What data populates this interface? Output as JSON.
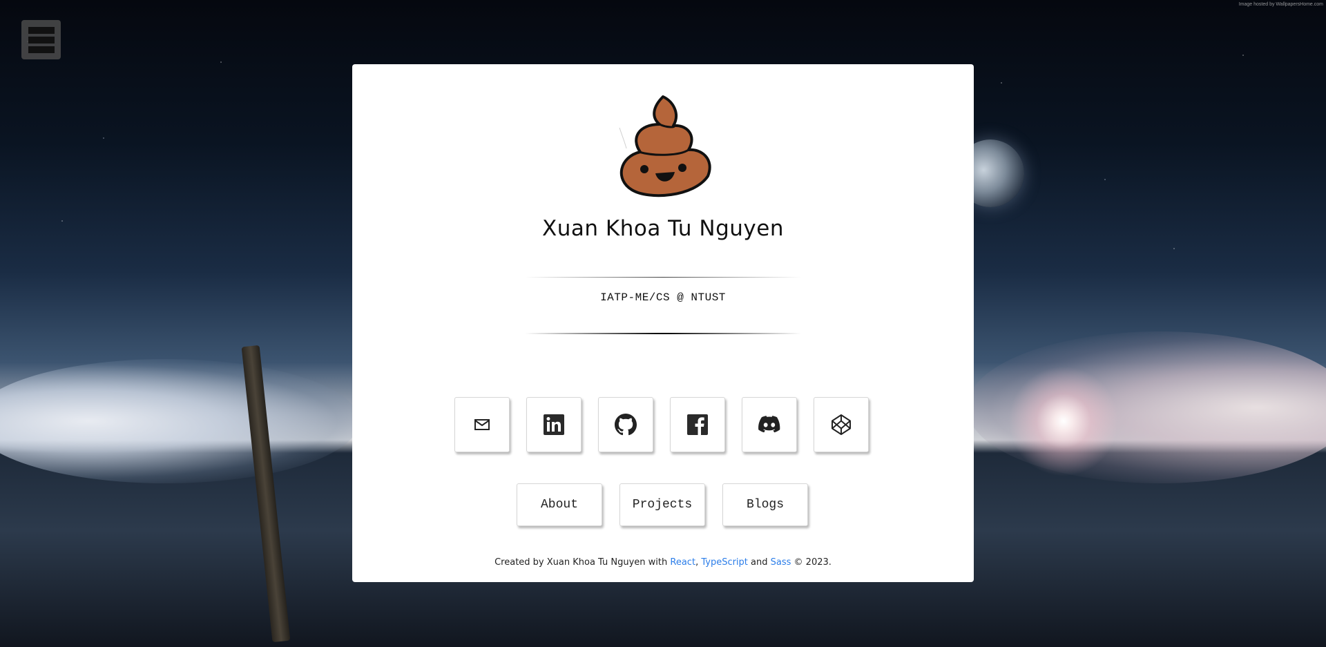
{
  "page": {
    "image_credit": "Image hosted by WallpapersHome.com"
  },
  "menu": {
    "icon": "menu-icon"
  },
  "profile": {
    "logo_icon": "poop-emoji-logo",
    "name": "Xuan Khoa Tu Nguyen",
    "tagline": "IATP-ME/CS @ NTUST"
  },
  "socials": [
    {
      "name": "email",
      "icon": "mail-icon"
    },
    {
      "name": "linkedin",
      "icon": "linkedin-icon"
    },
    {
      "name": "github",
      "icon": "github-icon"
    },
    {
      "name": "facebook",
      "icon": "facebook-icon"
    },
    {
      "name": "discord",
      "icon": "discord-icon"
    },
    {
      "name": "codepen",
      "icon": "codepen-icon"
    }
  ],
  "nav": {
    "about": "About",
    "projects": "Projects",
    "blogs": "Blogs"
  },
  "footer": {
    "prefix": "Created by Xuan Khoa Tu Nguyen with ",
    "react": "React",
    "comma": ", ",
    "typescript": "TypeScript",
    "and": " and ",
    "sass": "Sass",
    "suffix": " © 2023."
  },
  "colors": {
    "link": "#2b7de9",
    "card": "#ffffff",
    "logo_fill": "#b5653a"
  }
}
